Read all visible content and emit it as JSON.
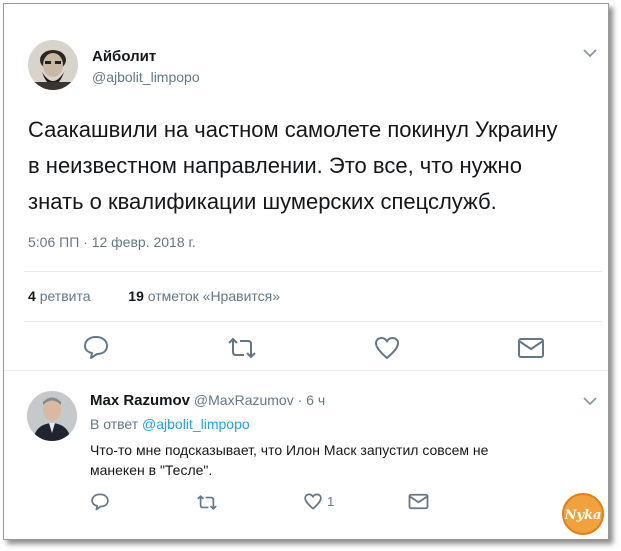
{
  "tweet": {
    "author_name": "Айболит",
    "author_handle": "@ajbolit_limpopo",
    "text_line1": "Саакашвили на частном самолете покинул Украину",
    "text_line2": "в неизвестном направлении. Это все, что нужно",
    "text_line3": "знать о квалификации шумерских спецслужб.",
    "timestamp": "5:06 ПП · 12 февр. 2018 г.",
    "retweet_count": "4",
    "retweet_label": "ретвита",
    "like_count": "19",
    "like_label": "отметок «Нравится»",
    "actions": [
      "reply-icon",
      "retweet-icon",
      "heart-icon",
      "message-icon"
    ]
  },
  "reply": {
    "author_name": "Max Razumov",
    "author_handle": "@MaxRazumov",
    "separator": "·",
    "time": "6 ч",
    "in_reply_prefix": "В ответ",
    "in_reply_mention": "@ajbolit_limpopo",
    "text_line1": "Что-то мне подсказывает, что Илон Маск запустил совсем не",
    "text_line2": "манекен в \"Тесле\".",
    "like_count": "1",
    "actions": [
      "reply-icon",
      "retweet-icon",
      "heart-icon",
      "message-icon"
    ]
  },
  "watermark_text": "Nyka",
  "colors": {
    "text": "#14171a",
    "secondary": "#657786",
    "link": "#1da1f2",
    "divider": "#e6ecf0",
    "icon": "#657786",
    "watermark": "#f2a23a"
  }
}
